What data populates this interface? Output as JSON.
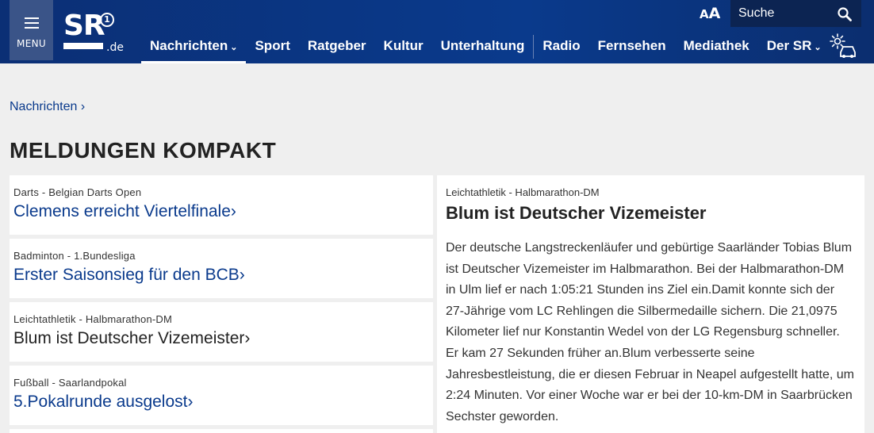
{
  "header": {
    "menu_label": "MENU",
    "logo": {
      "text": "SR",
      "circle": "1",
      "domain": ".de"
    },
    "nav": [
      {
        "label": "Nachrichten",
        "has_dropdown": true,
        "active": true
      },
      {
        "label": "Sport"
      },
      {
        "label": "Ratgeber"
      },
      {
        "label": "Kultur"
      },
      {
        "label": "Unterhaltung"
      },
      {
        "label": "Radio"
      },
      {
        "label": "Fernsehen"
      },
      {
        "label": "Mediathek"
      },
      {
        "label": "Der SR",
        "has_dropdown": true
      }
    ],
    "font_size_label_small": "A",
    "font_size_label_big": "A",
    "search_placeholder": "Suche",
    "icons": {
      "search": "search-icon",
      "traffic": "traffic-weather-icon"
    }
  },
  "breadcrumb": "Nachrichten ›",
  "page_title": "MELDUNGEN KOMPAKT",
  "cards": [
    {
      "category": "Darts - Belgian Darts Open",
      "headline": "Clemens erreicht Viertelfinale›",
      "style": "link"
    },
    {
      "category": "Badminton - 1.Bundesliga",
      "headline": "Erster Saisonsieg für den BCB›",
      "style": "link"
    },
    {
      "category": "Leichtathletik - Halbmarathon-DM",
      "headline": "Blum ist Deutscher Vizemeister›",
      "style": "active"
    },
    {
      "category": "Fußball - Saarlandpokal",
      "headline": "5.Pokalrunde ausgelost›",
      "style": "link"
    }
  ],
  "article": {
    "category": "Leichtathletik - Halbmarathon-DM",
    "title": "Blum ist Deutscher Vizemeister",
    "body": "Der deutsche Langstreckenläufer und gebürtige Saarländer Tobias Blum ist Deutscher Vizemeister im Halbmarathon. Bei der Halbmarathon-DM in Ulm lief er nach 1:05:21 Stunden ins Ziel ein.Damit konnte sich der 27-Jährige vom LC Rehlingen die Silbermedaille sichern. Die 21,0975 Kilometer lief nur Konstantin Wedel von der LG Regensburg schneller. Er kam 27 Sekunden früher an.Blum verbesserte seine Jahresbestleistung, die er diesen Februar in Neapel aufgestellt hatte, um 2:24 Minuten. Vor einer Woche war er bei der 10-km-DM in Saarbrücken Sechster geworden."
  },
  "colors": {
    "header_bg": "#0a3a8c",
    "link": "#0a3a8c",
    "page_bg": "#efefef"
  }
}
